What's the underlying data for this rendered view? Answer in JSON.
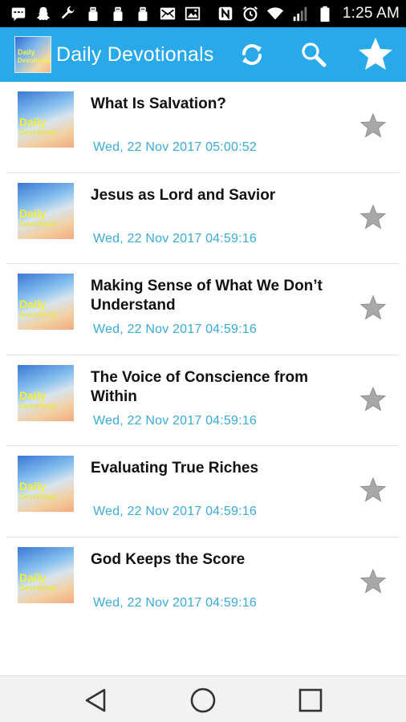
{
  "status_bar": {
    "time": "1:25 AM",
    "icons": [
      "message-icon",
      "snapchat-icon",
      "wrench-icon",
      "usb-icon",
      "usb-icon",
      "usb-icon",
      "mail-icon",
      "image-icon",
      "nfc-icon",
      "alarm-icon",
      "wifi-icon",
      "signal-icon",
      "battery-icon"
    ]
  },
  "app_bar": {
    "title": "Daily Devotionals",
    "logo_line1": "Daily",
    "logo_line2": "Devotional",
    "actions": [
      "refresh-icon",
      "search-icon",
      "star-icon"
    ],
    "color": "#29a9ea"
  },
  "thumb": {
    "line1": "Daily",
    "line2": "Devotional"
  },
  "items": [
    {
      "title": "What Is Salvation?",
      "date": "Wed, 22 Nov 2017 05:00:52"
    },
    {
      "title": "Jesus as Lord and Savior",
      "date": "Wed, 22 Nov 2017 04:59:16"
    },
    {
      "title": "Making Sense of What We Don’t Understand",
      "date": "Wed, 22 Nov 2017 04:59:16"
    },
    {
      "title": "The Voice of Conscience from Within",
      "date": "Wed, 22 Nov 2017 04:59:16"
    },
    {
      "title": "Evaluating True Riches",
      "date": "Wed, 22 Nov 2017 04:59:16"
    },
    {
      "title": "God Keeps the Score",
      "date": "Wed, 22 Nov 2017 04:59:16"
    }
  ],
  "colors": {
    "date": "#3aaad6",
    "star": "#a8a8a8"
  },
  "nav_bar": {
    "buttons": [
      "back-icon",
      "home-icon",
      "recents-icon"
    ]
  }
}
